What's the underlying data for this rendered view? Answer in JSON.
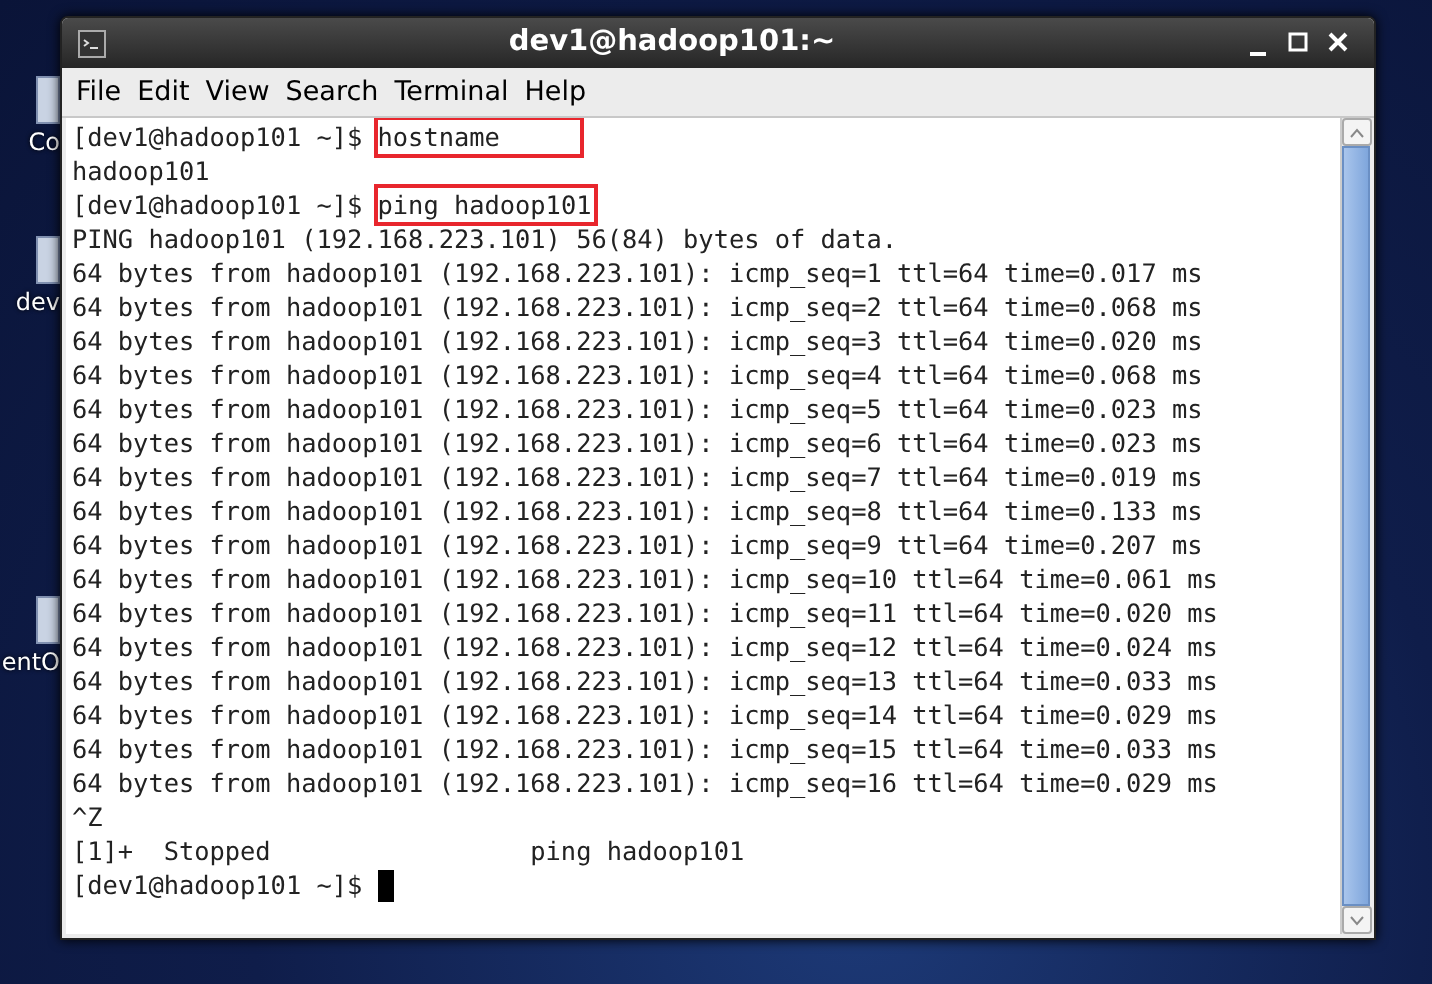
{
  "desktop": {
    "icons": [
      {
        "label": "Co"
      },
      {
        "label": "dev"
      },
      {
        "label": "entO"
      }
    ]
  },
  "window": {
    "title": "dev1@hadoop101:~"
  },
  "menu": [
    "File",
    "Edit",
    "View",
    "Search",
    "Terminal",
    "Help"
  ],
  "terminal": {
    "lines": [
      {
        "kind": "command",
        "prompt": "[dev1@hadoop101 ~]$ ",
        "command": "hostname",
        "highlighted": true
      },
      {
        "kind": "output",
        "text": "hadoop101"
      },
      {
        "kind": "command",
        "prompt": "[dev1@hadoop101 ~]$ ",
        "command": "ping hadoop101",
        "highlighted": true
      },
      {
        "kind": "output",
        "text": "PING hadoop101 (192.168.223.101) 56(84) bytes of data."
      },
      {
        "kind": "output",
        "text": "64 bytes from hadoop101 (192.168.223.101): icmp_seq=1 ttl=64 time=0.017 ms"
      },
      {
        "kind": "output",
        "text": "64 bytes from hadoop101 (192.168.223.101): icmp_seq=2 ttl=64 time=0.068 ms"
      },
      {
        "kind": "output",
        "text": "64 bytes from hadoop101 (192.168.223.101): icmp_seq=3 ttl=64 time=0.020 ms"
      },
      {
        "kind": "output",
        "text": "64 bytes from hadoop101 (192.168.223.101): icmp_seq=4 ttl=64 time=0.068 ms"
      },
      {
        "kind": "output",
        "text": "64 bytes from hadoop101 (192.168.223.101): icmp_seq=5 ttl=64 time=0.023 ms"
      },
      {
        "kind": "output",
        "text": "64 bytes from hadoop101 (192.168.223.101): icmp_seq=6 ttl=64 time=0.023 ms"
      },
      {
        "kind": "output",
        "text": "64 bytes from hadoop101 (192.168.223.101): icmp_seq=7 ttl=64 time=0.019 ms"
      },
      {
        "kind": "output",
        "text": "64 bytes from hadoop101 (192.168.223.101): icmp_seq=8 ttl=64 time=0.133 ms"
      },
      {
        "kind": "output",
        "text": "64 bytes from hadoop101 (192.168.223.101): icmp_seq=9 ttl=64 time=0.207 ms"
      },
      {
        "kind": "output",
        "text": "64 bytes from hadoop101 (192.168.223.101): icmp_seq=10 ttl=64 time=0.061 ms"
      },
      {
        "kind": "output",
        "text": "64 bytes from hadoop101 (192.168.223.101): icmp_seq=11 ttl=64 time=0.020 ms"
      },
      {
        "kind": "output",
        "text": "64 bytes from hadoop101 (192.168.223.101): icmp_seq=12 ttl=64 time=0.024 ms"
      },
      {
        "kind": "output",
        "text": "64 bytes from hadoop101 (192.168.223.101): icmp_seq=13 ttl=64 time=0.033 ms"
      },
      {
        "kind": "output",
        "text": "64 bytes from hadoop101 (192.168.223.101): icmp_seq=14 ttl=64 time=0.029 ms"
      },
      {
        "kind": "output",
        "text": "64 bytes from hadoop101 (192.168.223.101): icmp_seq=15 ttl=64 time=0.033 ms"
      },
      {
        "kind": "output",
        "text": "64 bytes from hadoop101 (192.168.223.101): icmp_seq=16 ttl=64 time=0.029 ms"
      },
      {
        "kind": "output",
        "text": "^Z"
      },
      {
        "kind": "output",
        "text": "[1]+  Stopped                 ping hadoop101"
      },
      {
        "kind": "prompt",
        "prompt": "[dev1@hadoop101 ~]$ ",
        "cursor": true
      }
    ]
  }
}
